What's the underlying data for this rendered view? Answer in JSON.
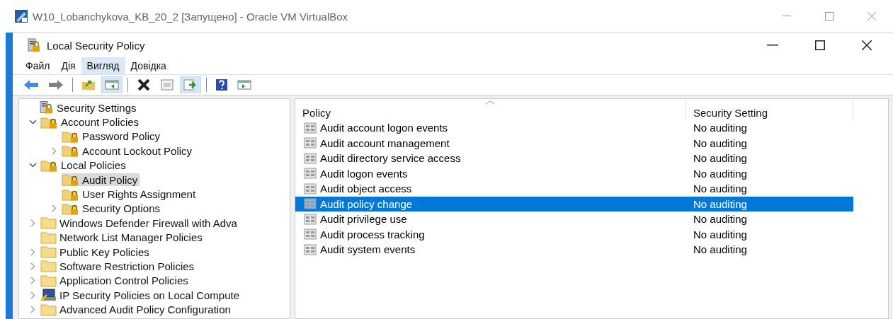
{
  "outer_window": {
    "title": "W10_Lobanchykova_KB_20_2 [Запущено] - Oracle VM VirtualBox"
  },
  "window": {
    "title": "Local Security Policy"
  },
  "menu": [
    {
      "label": "Файл",
      "selected": false
    },
    {
      "label": "Дія",
      "selected": false
    },
    {
      "label": "Вигляд",
      "selected": true
    },
    {
      "label": "Довідка",
      "selected": false
    }
  ],
  "toolbar": [
    {
      "kind": "back",
      "pressed": false
    },
    {
      "kind": "forward",
      "pressed": false
    },
    {
      "kind": "separator"
    },
    {
      "kind": "up",
      "pressed": false
    },
    {
      "kind": "tree",
      "pressed": true
    },
    {
      "kind": "separator"
    },
    {
      "kind": "delete",
      "pressed": false
    },
    {
      "kind": "properties",
      "pressed": false
    },
    {
      "kind": "export",
      "pressed": true
    },
    {
      "kind": "separator"
    },
    {
      "kind": "help",
      "pressed": false
    },
    {
      "kind": "action-pane",
      "pressed": false
    }
  ],
  "tree": {
    "items": [
      {
        "label": "Security Settings",
        "kind": "server",
        "selected": false,
        "children": [
          {
            "label": "Account Policies",
            "kind": "secure-folder",
            "expanded": true,
            "selected": false,
            "children": [
              {
                "label": "Password Policy",
                "kind": "secure-folder",
                "selected": false
              },
              {
                "label": "Account Lockout Policy",
                "kind": "secure-folder",
                "expanded": false,
                "selected": false
              }
            ]
          },
          {
            "label": "Local Policies",
            "kind": "secure-folder",
            "expanded": true,
            "selected": false,
            "children": [
              {
                "label": "Audit Policy",
                "kind": "secure-folder",
                "selected": true
              },
              {
                "label": "User Rights Assignment",
                "kind": "secure-folder",
                "selected": false
              },
              {
                "label": "Security Options",
                "kind": "secure-folder",
                "expanded": false,
                "selected": false
              }
            ]
          },
          {
            "label": "Windows Defender Firewall with Adva",
            "kind": "folder",
            "expanded": false,
            "selected": false
          },
          {
            "label": "Network List Manager Policies",
            "kind": "folder",
            "selected": false
          },
          {
            "label": "Public Key Policies",
            "kind": "folder",
            "expanded": false,
            "selected": false
          },
          {
            "label": "Software Restriction Policies",
            "kind": "folder",
            "expanded": false,
            "selected": false
          },
          {
            "label": "Application Control Policies",
            "kind": "folder",
            "expanded": false,
            "selected": false
          },
          {
            "label": "IP Security Policies on Local Compute",
            "kind": "computer",
            "expanded": false,
            "selected": false
          },
          {
            "label": "Advanced Audit Policy Configuration",
            "kind": "folder",
            "expanded": false,
            "selected": false
          }
        ]
      }
    ]
  },
  "table": {
    "columns": [
      "Policy",
      "Security Setting"
    ],
    "rows": [
      {
        "policy": "Audit account logon events",
        "setting": "No auditing",
        "selected": false
      },
      {
        "policy": "Audit account management",
        "setting": "No auditing",
        "selected": false
      },
      {
        "policy": "Audit directory service access",
        "setting": "No auditing",
        "selected": false
      },
      {
        "policy": "Audit logon events",
        "setting": "No auditing",
        "selected": false
      },
      {
        "policy": "Audit object access",
        "setting": "No auditing",
        "selected": false
      },
      {
        "policy": "Audit policy change",
        "setting": "No auditing",
        "selected": true
      },
      {
        "policy": "Audit privilege use",
        "setting": "No auditing",
        "selected": false
      },
      {
        "policy": "Audit process tracking",
        "setting": "No auditing",
        "selected": false
      },
      {
        "policy": "Audit system events",
        "setting": "No auditing",
        "selected": false
      }
    ]
  }
}
